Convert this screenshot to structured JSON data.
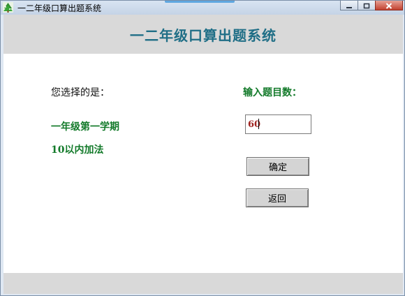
{
  "window": {
    "title": "一二年级口算出题系统"
  },
  "header": {
    "title": "一二年级口算出题系统"
  },
  "selection": {
    "prompt": "您选择的是：",
    "grade_term": "一年级第一学期",
    "topic": "10以内加法"
  },
  "count": {
    "label": "输入题目数：",
    "value": "60"
  },
  "buttons": {
    "confirm": "确定",
    "back": "返回"
  },
  "icons": {
    "app": "tree-app-icon",
    "minimize": "minimize-icon",
    "maximize": "maximize-icon",
    "close": "close-icon"
  },
  "colors": {
    "title": "#1f6e86",
    "green_text": "#137a2a",
    "input_text": "#a0221f",
    "band": "#d9d9d9"
  }
}
